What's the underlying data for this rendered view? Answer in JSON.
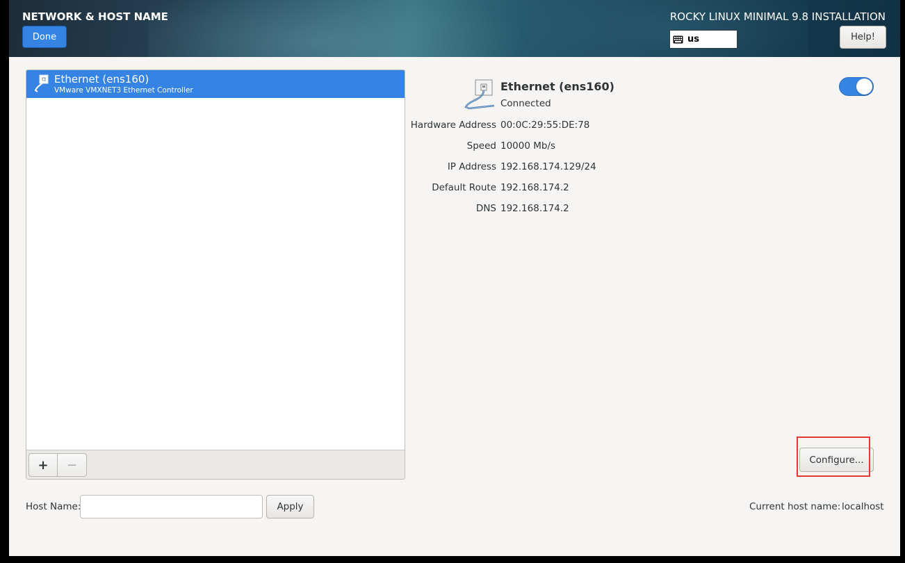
{
  "header": {
    "page_title": "NETWORK & HOST NAME",
    "done_label": "Done",
    "install_title": "ROCKY LINUX MINIMAL 9.8 INSTALLATION",
    "keyboard_layout": "us",
    "help_label": "Help!"
  },
  "devices": [
    {
      "name": "Ethernet (ens160)",
      "subtitle": "VMware VMXNET3 Ethernet Controller",
      "selected": true,
      "icon": "ethernet-cable-icon"
    }
  ],
  "list_toolbar": {
    "add_label": "+",
    "remove_label": "−"
  },
  "details": {
    "name": "Ethernet (ens160)",
    "status": "Connected",
    "enabled": true,
    "properties": [
      {
        "label": "Hardware Address",
        "value": "00:0C:29:55:DE:78"
      },
      {
        "label": "Speed",
        "value": "10000 Mb/s"
      },
      {
        "label": "IP Address",
        "value": "192.168.174.129/24"
      },
      {
        "label": "Default Route",
        "value": "192.168.174.2"
      },
      {
        "label": "DNS",
        "value": "192.168.174.2"
      }
    ],
    "configure_label": "Configure..."
  },
  "hostname": {
    "label": "Host Name:",
    "value": "",
    "placeholder": "",
    "apply_label": "Apply",
    "current_label": "Current host name:",
    "current_value": "localhost"
  },
  "colors": {
    "accent": "#3584e4",
    "highlight": "#e53935",
    "background": "#f6f5f4"
  }
}
